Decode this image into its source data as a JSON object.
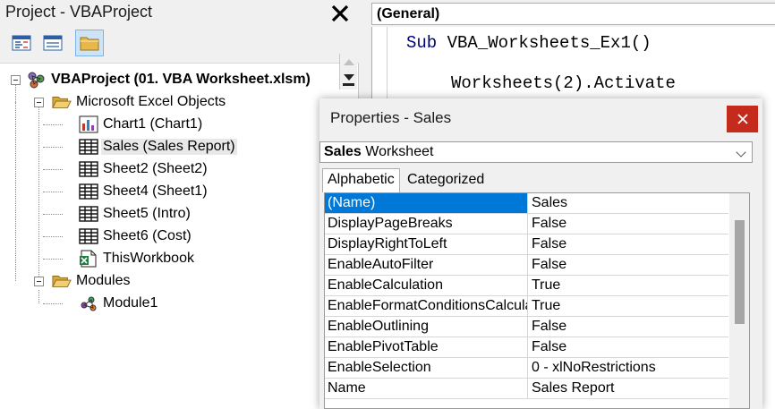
{
  "project": {
    "title": "Project - VBAProject",
    "toolbar": {
      "view_code_icon": "view-code-icon",
      "view_object_icon": "view-object-icon",
      "toggle_folders_icon": "folder-icon"
    },
    "tree": {
      "root": "VBAProject (01. VBA Worksheet.xlsm)",
      "excel_objects_folder": "Microsoft Excel Objects",
      "excel_objects": [
        {
          "label": "Chart1 (Chart1)",
          "icon": "chart-sheet-icon"
        },
        {
          "label": "Sales (Sales Report)",
          "icon": "worksheet-icon"
        },
        {
          "label": "Sheet2 (Sheet2)",
          "icon": "worksheet-icon"
        },
        {
          "label": "Sheet4 (Sheet1)",
          "icon": "worksheet-icon"
        },
        {
          "label": "Sheet5 (Intro)",
          "icon": "worksheet-icon"
        },
        {
          "label": "Sheet6 (Cost)",
          "icon": "worksheet-icon"
        },
        {
          "label": "ThisWorkbook",
          "icon": "workbook-icon"
        }
      ],
      "modules_folder": "Modules",
      "modules": [
        {
          "label": "Module1",
          "icon": "module-icon"
        }
      ]
    }
  },
  "code": {
    "object_combo": "(General)",
    "line1_keyword": "Sub",
    "line1_rest": " VBA_Worksheets_Ex1()",
    "line2": "Worksheets(2).Activate"
  },
  "properties": {
    "title": "Properties - Sales",
    "object_name": "Sales",
    "object_type": " Worksheet",
    "tab_alphabetic": "Alphabetic",
    "tab_categorized": "Categorized",
    "rows": [
      {
        "name": "(Name)",
        "value": "Sales"
      },
      {
        "name": "DisplayPageBreaks",
        "value": "False"
      },
      {
        "name": "DisplayRightToLeft",
        "value": "False"
      },
      {
        "name": "EnableAutoFilter",
        "value": "False"
      },
      {
        "name": "EnableCalculation",
        "value": "True"
      },
      {
        "name": "EnableFormatConditionsCalculation",
        "value": "True"
      },
      {
        "name": "EnableOutlining",
        "value": "False"
      },
      {
        "name": "EnablePivotTable",
        "value": "False"
      },
      {
        "name": "EnableSelection",
        "value": "0 - xlNoRestrictions"
      },
      {
        "name": "Name",
        "value": "Sales Report"
      }
    ]
  },
  "colors": {
    "selection": "#0078d7",
    "close_button": "#c42b1c",
    "keyword": "#000080"
  }
}
